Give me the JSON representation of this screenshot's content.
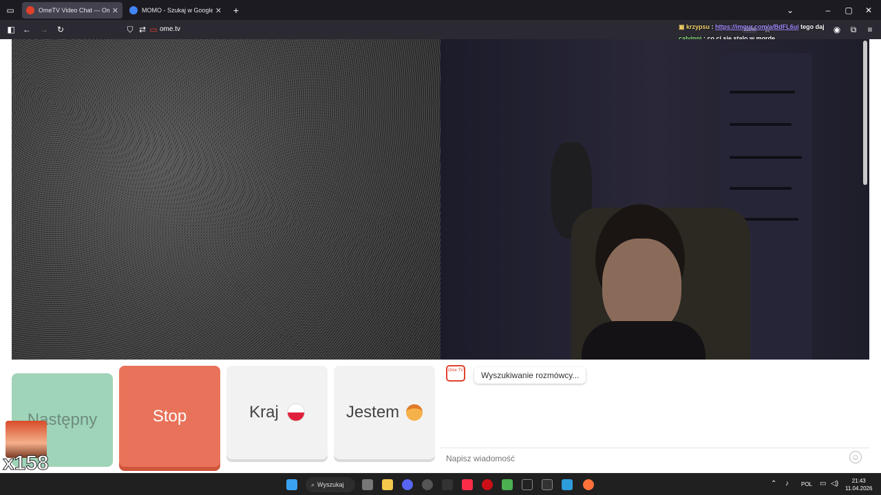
{
  "browser": {
    "tabs": [
      {
        "title": "OmeTV Video Chat — Ome",
        "active": true,
        "favicon_color": "#e0412c"
      },
      {
        "title": "MOMO - Szukaj w Google",
        "active": false,
        "favicon_color": "#4285f4"
      }
    ],
    "url": "ome.tv",
    "zoom": "120%"
  },
  "stream_chat": [
    {
      "user": "krzypsu",
      "text": "https://imgur.com/a/BdFL6ui",
      "suffix": "tego daj",
      "user_color": "#f2d16b",
      "text_color": "#a68cff"
    },
    {
      "user": "calvinni",
      "text": "co ci sie stalo w morde",
      "suffix": "",
      "user_color": "#8be17c",
      "text_color": "#ffffff"
    }
  ],
  "buttons": {
    "next": "Następny",
    "stop": "Stop",
    "country": "Kraj",
    "gender": "Jestem"
  },
  "chat": {
    "status": "Wyszukiwanie rozmówcy...",
    "logo_text": "Ome TV",
    "placeholder": "Napisz wiadomość"
  },
  "overlay": {
    "counter": "x158"
  },
  "taskbar": {
    "search": "Wyszukaj",
    "lang": "POL",
    "time": "21:43",
    "date": "11.04.2026"
  },
  "colors": {
    "next_bg": "#9fd4b8",
    "stop_bg": "#e8735a",
    "neutral_btn_bg": "#f2f2f2",
    "accent": "#e0412c"
  }
}
